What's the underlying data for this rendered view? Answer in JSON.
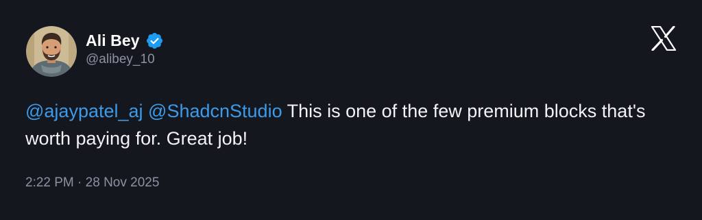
{
  "tweet": {
    "author": {
      "display_name": "Ali Bey",
      "handle": "@alibey_10",
      "verified": true
    },
    "mentions": [
      "@ajaypatel_aj",
      "@ShadcnStudio"
    ],
    "body_text": "This is one of the few premium blocks that's worth paying for. Great job!",
    "time": "2:22 PM",
    "separator": "·",
    "date": "28 Nov 2025"
  },
  "colors": {
    "background": "#15171f",
    "mention": "#3b9bea",
    "verified_badge": "#1d9bf0",
    "muted_text": "#8b93a3"
  },
  "icons": {
    "verified": "verified-badge-icon",
    "platform": "x-logo-icon"
  }
}
